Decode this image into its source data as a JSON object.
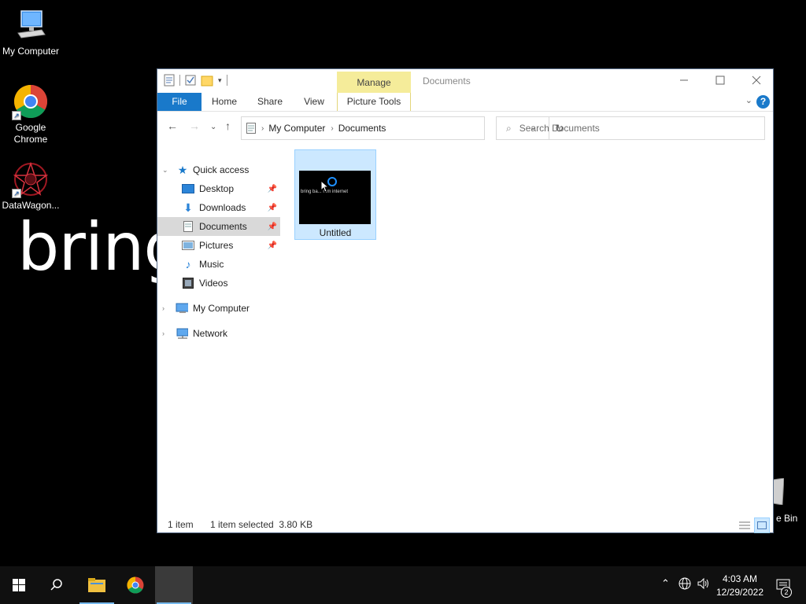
{
  "desktop": {
    "wallpaper_text": "bring",
    "icons": [
      {
        "label": "My Computer",
        "icon": "computer-icon"
      },
      {
        "label": "Google Chrome",
        "icon": "chrome-icon"
      },
      {
        "label": "DataWagon...",
        "icon": "datawagon-icon"
      }
    ],
    "recycle_bin_label": "e Bin"
  },
  "window": {
    "title": "Documents",
    "manage_tab": "Manage",
    "ribbon_tabs": {
      "file": "File",
      "home": "Home",
      "share": "Share",
      "view": "View",
      "picture_tools": "Picture Tools"
    },
    "help": "?",
    "address": {
      "root": "My Computer",
      "current": "Documents"
    },
    "search_placeholder": "Search Documents",
    "nav": {
      "quick_access": "Quick access",
      "desktop": "Desktop",
      "downloads": "Downloads",
      "documents": "Documents",
      "pictures": "Pictures",
      "music": "Music",
      "videos": "Videos",
      "my_computer": "My Computer",
      "network": "Network"
    },
    "files": [
      {
        "name": "Untitled",
        "thumbnail_text": "bring ba... mm internet"
      }
    ],
    "status": {
      "count": "1 item",
      "selection": "1 item selected  3.80 KB"
    }
  },
  "taskbar": {
    "time": "4:03 AM",
    "date": "12/29/2022",
    "notification_count": "2"
  },
  "colors": {
    "accent": "#1979ca",
    "manage_tab": "#f5ec9a",
    "selection": "#cce8ff"
  }
}
